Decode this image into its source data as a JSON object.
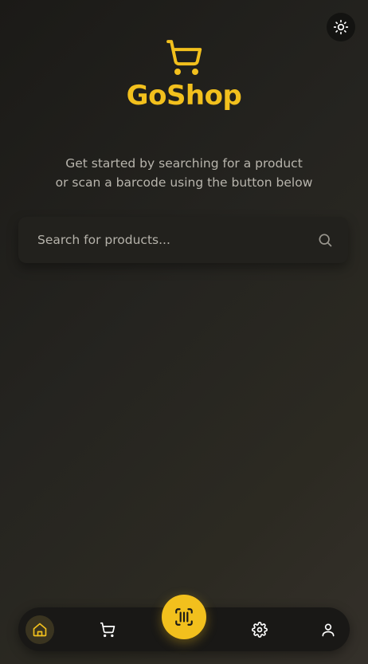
{
  "app": {
    "name": "GoShop"
  },
  "intro": {
    "line1": "Get started by searching for a product",
    "line2": "or scan a barcode using the button below"
  },
  "search": {
    "placeholder": "Search for products...",
    "value": ""
  },
  "theme_toggle": {
    "icon": "sun-icon"
  },
  "nav": {
    "items": [
      {
        "id": "home",
        "icon": "home-icon",
        "active": true
      },
      {
        "id": "cart",
        "icon": "cart-icon",
        "active": false
      },
      {
        "id": "scan",
        "icon": "barcode-scan-icon",
        "active": false
      },
      {
        "id": "settings",
        "icon": "gear-icon",
        "active": false
      },
      {
        "id": "profile",
        "icon": "user-icon",
        "active": false
      }
    ]
  },
  "colors": {
    "accent": "#f2c01d",
    "background": "#252420",
    "text_muted": "#b8b5ad",
    "nav_background": "#191816"
  }
}
